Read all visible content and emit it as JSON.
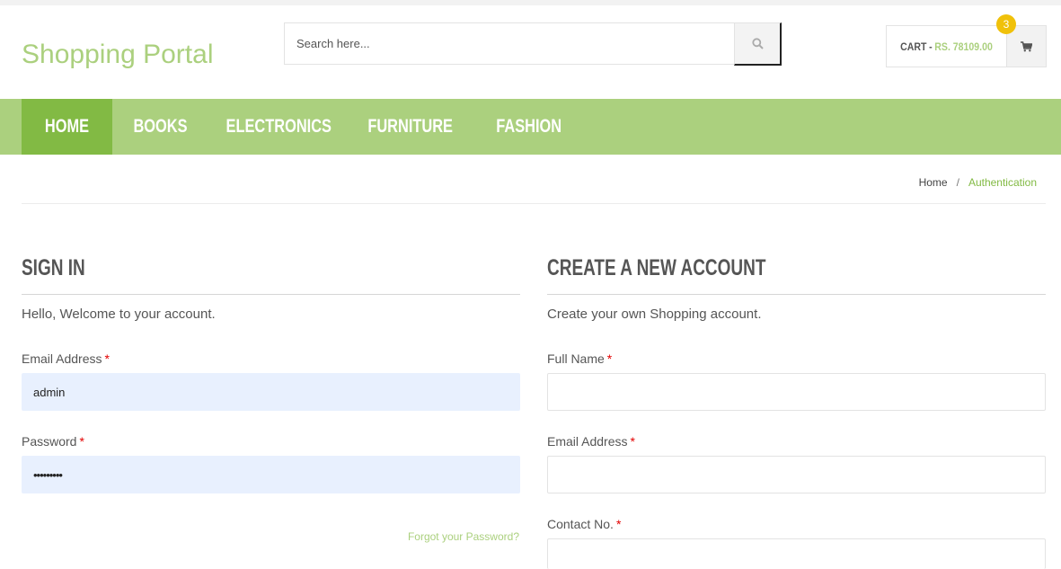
{
  "header": {
    "logo": "Shopping Portal",
    "search": {
      "placeholder": "Search here...",
      "value": ""
    },
    "cart": {
      "label": "CART",
      "separator": "-",
      "amount": "RS. 78109.00",
      "count": "3"
    }
  },
  "nav": {
    "items": [
      {
        "label": "HOME",
        "active": true
      },
      {
        "label": "BOOKS",
        "active": false
      },
      {
        "label": "ELECTRONICS",
        "active": false
      },
      {
        "label": "FURNITURE",
        "active": false
      },
      {
        "label": "FASHION",
        "active": false
      }
    ]
  },
  "breadcrumb": {
    "home": "Home",
    "separator": "/",
    "current": "Authentication"
  },
  "signin": {
    "title": "SIGN IN",
    "intro": "Hello, Welcome to your account.",
    "email_label": "Email Address",
    "email_value": "admin",
    "password_label": "Password",
    "password_value": "•••••••••",
    "forgot": "Forgot your Password?",
    "required_mark": "*"
  },
  "register": {
    "title": "CREATE A NEW ACCOUNT",
    "intro": "Create your own Shopping account.",
    "fullname_label": "Full Name",
    "email_label": "Email Address",
    "contact_label": "Contact No.",
    "required_mark": "*"
  },
  "colors": {
    "brand": "#abd07e",
    "nav_active": "#82ba44",
    "badge": "#f0c10a",
    "required": "#e30000",
    "autofill": "#e8f0fe"
  },
  "icons": {
    "search": "search-icon",
    "cart": "shopping-cart-icon"
  }
}
